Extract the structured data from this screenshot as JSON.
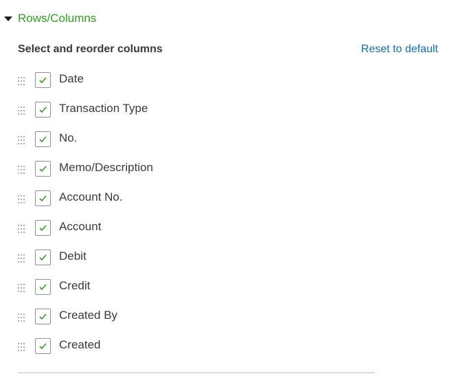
{
  "section": {
    "title": "Rows/Columns",
    "expanded": true
  },
  "columns_panel": {
    "heading": "Select and reorder columns",
    "reset_label": "Reset to default",
    "items": [
      {
        "label": "Date",
        "checked": true
      },
      {
        "label": "Transaction Type",
        "checked": true
      },
      {
        "label": "No.",
        "checked": true
      },
      {
        "label": "Memo/Description",
        "checked": true
      },
      {
        "label": "Account No.",
        "checked": true
      },
      {
        "label": "Account",
        "checked": true
      },
      {
        "label": "Debit",
        "checked": true
      },
      {
        "label": "Credit",
        "checked": true
      },
      {
        "label": "Created By",
        "checked": true
      },
      {
        "label": "Created",
        "checked": true
      }
    ]
  },
  "colors": {
    "accent_green": "#2ca01c",
    "link_blue": "#0d6fb8",
    "text_dark": "#393a3d",
    "check_green": "#2ca01c"
  },
  "icons": {
    "caret": "caret-down-icon",
    "drag": "drag-handle-icon",
    "check": "checkmark-icon"
  }
}
